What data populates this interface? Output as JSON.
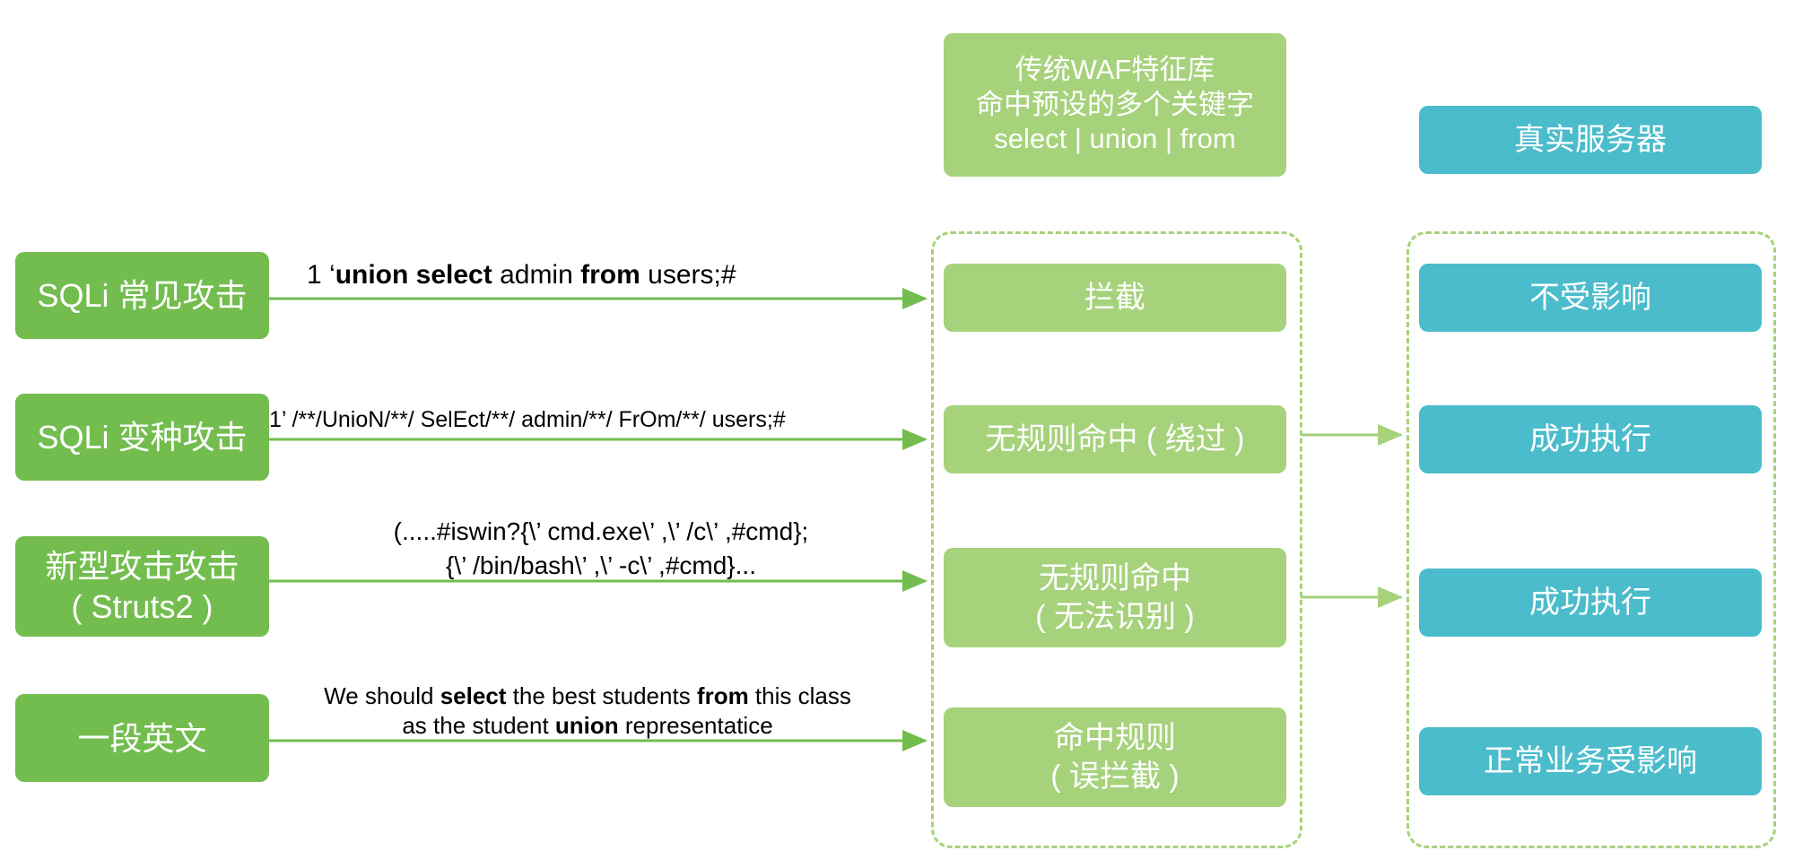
{
  "waf_header": {
    "line1": "传统WAF特征库",
    "line2": "命中预设的多个关键字",
    "line3": "select | union | from"
  },
  "server_header": "真实服务器",
  "attacks": [
    {
      "line1": "SQLi 常见攻击",
      "line2": ""
    },
    {
      "line1": "SQLi 变种攻击",
      "line2": ""
    },
    {
      "line1": "新型攻击攻击",
      "line2": "( Struts2 )"
    },
    {
      "line1": "一段英文",
      "line2": ""
    }
  ],
  "payloads": [
    {
      "parts": [
        "1 ‘",
        "union select",
        " admin ",
        "from",
        " users;#"
      ]
    },
    {
      "text": "1’ /**/UnioN/**/ SelEct/**/ admin/**/ FrOm/**/ users;#"
    },
    {
      "line1": "(.....#iswin?{\\’ cmd.exe\\’ ,\\’ /c\\’ ,#cmd};",
      "line2": "{\\’ /bin/bash\\’ ,\\’ -c\\’ ,#cmd}..."
    },
    {
      "line1_parts": [
        "We should ",
        "select",
        " the best students ",
        "from",
        " this class"
      ],
      "line2_parts": [
        "as the student ",
        "union",
        " representatice"
      ]
    }
  ],
  "waf_results": [
    {
      "line1": "拦截",
      "line2": ""
    },
    {
      "line1": "无规则命中 ( 绕过 )",
      "line2": ""
    },
    {
      "line1": "无规则命中",
      "line2": "( 无法识别 )"
    },
    {
      "line1": "命中规则",
      "line2": "( 误拦截 )"
    }
  ],
  "server_results": [
    "不受影响",
    "成功执行",
    "成功执行",
    "正常业务受影响"
  ],
  "colors": {
    "attack_green": "#73bd4f",
    "waf_green": "#a6d27c",
    "server_teal": "#4bbccb",
    "arrow_green": "#73bd4f"
  }
}
